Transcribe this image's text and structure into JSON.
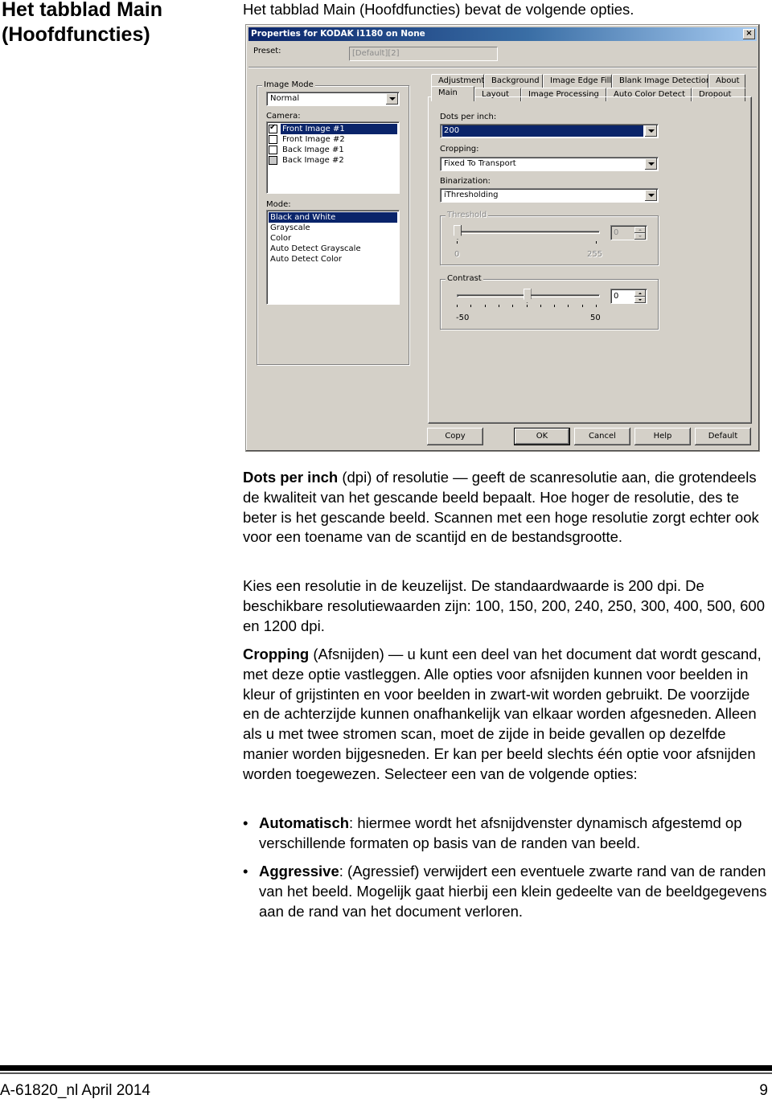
{
  "section_title": "Het tabblad Main (Hoofdfuncties)",
  "intro": "Het tabblad Main (Hoofdfuncties) bevat de volgende opties.",
  "dialog": {
    "title": "Properties for KODAK i1180 on None",
    "close_icon": "×",
    "preset_label": "Preset:",
    "preset_value": "[Default][2]",
    "image_mode": {
      "label": "Image Mode",
      "value": "Normal",
      "camera_label": "Camera:",
      "camera_items": [
        {
          "label": "Front Image #1",
          "checked": true,
          "selected": true
        },
        {
          "label": "Front Image #2",
          "checked": false,
          "selected": false
        },
        {
          "label": "Back Image #1",
          "checked": false,
          "selected": false
        },
        {
          "label": "Back Image #2",
          "checked": false,
          "selected": false,
          "greyed": true
        }
      ],
      "mode_label": "Mode:",
      "mode_items": [
        {
          "label": "Black and White",
          "selected": true
        },
        {
          "label": "Grayscale"
        },
        {
          "label": "Color"
        },
        {
          "label": "Auto Detect Grayscale"
        },
        {
          "label": "Auto Detect Color"
        }
      ]
    },
    "tabs_back": [
      "Adjustments",
      "Background",
      "Image Edge Fill",
      "Blank Image Detection",
      "About"
    ],
    "tabs_front": [
      "Main",
      "Layout",
      "Image Processing",
      "Auto Color Detect",
      "Dropout"
    ],
    "active_tab": "Main",
    "main": {
      "dpi_label": "Dots per inch:",
      "dpi_value": "200",
      "cropping_label": "Cropping:",
      "cropping_value": "Fixed To Transport",
      "binarization_label": "Binarization:",
      "binarization_value": "iThresholding",
      "threshold": {
        "label": "Threshold",
        "min_label": "0",
        "max_label": "255",
        "min": 0,
        "max": 255,
        "value": 0,
        "value_text": "0",
        "enabled": false
      },
      "contrast": {
        "label": "Contrast",
        "min_label": "-50",
        "max_label": "50",
        "min": -50,
        "max": 50,
        "value": 0,
        "value_text": "0",
        "tick_count": 11,
        "enabled": true
      }
    },
    "buttons": {
      "copy": "Copy",
      "ok": "OK",
      "cancel": "Cancel",
      "help": "Help",
      "default": "Default"
    }
  },
  "body": {
    "p1_bold": "Dots per inch",
    "p1_rest": " (dpi) of resolutie — geeft de scanresolutie aan, die grotendeels de kwaliteit van het gescande beeld bepaalt. Hoe hoger de resolutie, des te beter is het gescande beeld. Scannen met een hoge resolutie zorgt echter ook voor een toename van de scantijd en de bestandsgrootte.",
    "p2": "Kies een resolutie in de keuzelijst. De standaardwaarde is 200 dpi. De beschikbare resolutiewaarden zijn: 100, 150, 200, 240, 250, 300, 400, 500, 600 en 1200 dpi.",
    "p3_bold": "Cropping",
    "p3_rest": " (Afsnijden) — u kunt een deel van het document dat wordt gescand, met deze optie vastleggen. Alle opties voor afsnijden kunnen voor beelden in kleur of grijstinten en voor beelden in zwart-wit worden gebruikt. De voorzijde en de achterzijde kunnen onafhankelijk van elkaar worden afgesneden. Alleen als u met twee stromen scan, moet de zijde in beide gevallen op dezelfde manier worden bijgesneden. Er kan per beeld slechts één optie voor afsnijden worden toegewezen. Selecteer een van de volgende opties:",
    "bullets": [
      {
        "bold": "Automatisch",
        "rest": ": hiermee wordt het afsnijdvenster dynamisch afgestemd op verschillende formaten op basis van de randen van beeld."
      },
      {
        "bold": "Aggressive",
        "rest": ": (Agressief) verwijdert een eventuele zwarte rand van de randen van het beeld. Mogelijk gaat hierbij een klein gedeelte van de beeldgegevens aan de rand van het document verloren."
      }
    ],
    "bullet_glyph": "•"
  },
  "footer": {
    "doc_id": "A-61820_nl  April 2014",
    "page_number": "9"
  }
}
